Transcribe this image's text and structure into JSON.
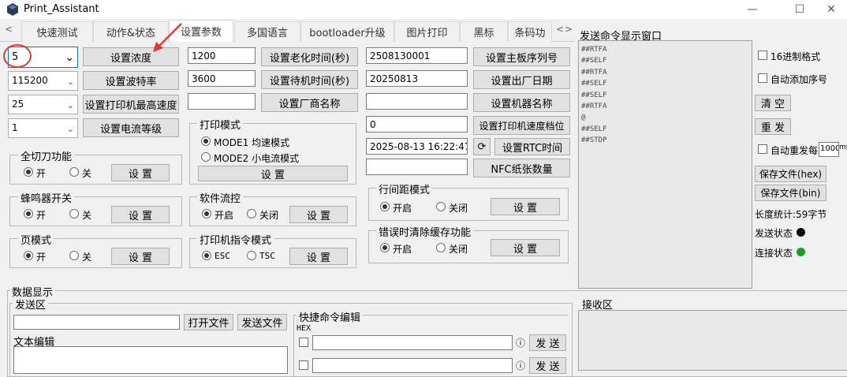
{
  "window": {
    "title": "Print_Assistant",
    "min_label": "—",
    "max_label": "☐",
    "close_label": "✕"
  },
  "tabs": [
    "快速测试",
    "动作&状态",
    "设置参数",
    "多国语言",
    "bootloader升级",
    "图片打印",
    "黑标",
    "条码功"
  ],
  "tab_scroll": {
    "left": "<",
    "right": ">"
  },
  "settings": {
    "density_value": "5",
    "density_button": "设置浓度",
    "baud_value": "115200",
    "baud_button": "设置波特率",
    "speed_value": "25",
    "speed_button": "设置打印机最高速度",
    "current_value": "1",
    "current_button": "设置电流等级",
    "aging_value": "1200",
    "aging_button": "设置老化时间(秒)",
    "standby_value": "3600",
    "standby_button": "设置待机时间(秒)",
    "vendor_value": "",
    "vendor_button": "设置厂商名称",
    "serial_value": "2508130001",
    "serial_button": "设置主板序列号",
    "date_value": "20250813",
    "date_button": "设置出厂日期",
    "machine_value": "",
    "machine_button": "设置机器名称",
    "speedlevel_value": "0",
    "speedlevel_button": "设置打印机速度档位",
    "rtc_value": "2025-08-13 16:22:47",
    "rtc_refresh": "⟳",
    "rtc_button": "设置RTC时间",
    "nfc_value": "",
    "nfc_button": "NFC纸张数量"
  },
  "groups": {
    "cutter": {
      "label": "全切刀功能",
      "on": "开",
      "off": "关",
      "button": "设 置"
    },
    "buzzer": {
      "label": "蜂鸣器开关",
      "on": "开",
      "off": "关",
      "button": "设 置"
    },
    "page": {
      "label": "页模式",
      "on": "开",
      "off": "关",
      "button": "设 置"
    },
    "print_mode": {
      "label": "打印模式",
      "mode1": "MODE1 均速模式",
      "mode2": "MODE2 小电流模式",
      "button": "设 置"
    },
    "flow": {
      "label": "软件流控",
      "on": "开启",
      "off": "关闭",
      "button": "设 置"
    },
    "cmd_mode": {
      "label": "打印机指令模式",
      "esc": "ESC",
      "tsc": "TSC",
      "button": "设 置"
    },
    "line_spacing": {
      "label": "行间距模式",
      "on": "开启",
      "off": "关闭",
      "button": "设 置"
    },
    "clear_cache": {
      "label": "错误时清除缓存功能",
      "on": "开启",
      "off": "关闭",
      "button": "设 置"
    }
  },
  "log": {
    "title": "发送命令显示窗口",
    "lines": [
      "##RTFA",
      "##SELF",
      "##RTFA",
      "##SELF",
      "##SELF",
      "##RTFA",
      "@",
      "##SELF",
      "##STDP"
    ]
  },
  "right_panel": {
    "hex_format": "16进制格式",
    "auto_seq": "自动添加序号",
    "clear_button": "清 空",
    "resend_button": "重 发",
    "auto_resend": "自动重发每",
    "auto_resend_value": "1000",
    "auto_resend_unit": "ms",
    "save_hex": "保存文件(hex)",
    "save_bin": "保存文件(bin)",
    "length_stat": "长度统计:59字节",
    "send_status": "发送状态",
    "conn_status": "连接状态",
    "send_color": "#000000",
    "conn_color": "#1a9e2a"
  },
  "data_display": {
    "title": "数据显示",
    "send_area": "发送区",
    "send_value": "",
    "open_file": "打开文件",
    "send_file": "发送文件",
    "text_edit": "文本编辑",
    "quick_cmd": "快捷命令编辑",
    "hex_label": "HEX",
    "send_btn": "发 送",
    "info_icon": "ⓘ",
    "recv_area": "接收区"
  },
  "colors": {
    "accent": "#0078d7",
    "annotation": "#e03a2f"
  }
}
